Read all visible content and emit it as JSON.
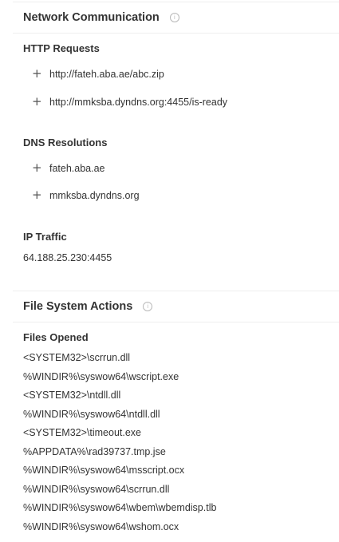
{
  "network": {
    "title": "Network Communication",
    "info_icon": "info-icon",
    "http_title": "HTTP Requests",
    "http": [
      "http://fateh.aba.ae/abc.zip",
      "http://mmksba.dyndns.org:4455/is-ready"
    ],
    "dns_title": "DNS Resolutions",
    "dns": [
      "fateh.aba.ae",
      "mmksba.dyndns.org"
    ],
    "ip_title": "IP Traffic",
    "ip": [
      "64.188.25.230:4455"
    ]
  },
  "filesystem": {
    "title": "File System Actions",
    "info_icon": "info-icon",
    "opened_title": "Files Opened",
    "opened": [
      "<SYSTEM32>\\scrrun.dll",
      "%WINDIR%\\syswow64\\wscript.exe",
      "<SYSTEM32>\\ntdll.dll",
      "%WINDIR%\\syswow64\\ntdll.dll",
      "<SYSTEM32>\\timeout.exe",
      "%APPDATA%\\rad39737.tmp.jse",
      "%WINDIR%\\syswow64\\msscript.ocx",
      "%WINDIR%\\syswow64\\scrrun.dll",
      "%WINDIR%\\syswow64\\wbem\\wbemdisp.tlb",
      "%WINDIR%\\syswow64\\wshom.ocx"
    ]
  }
}
